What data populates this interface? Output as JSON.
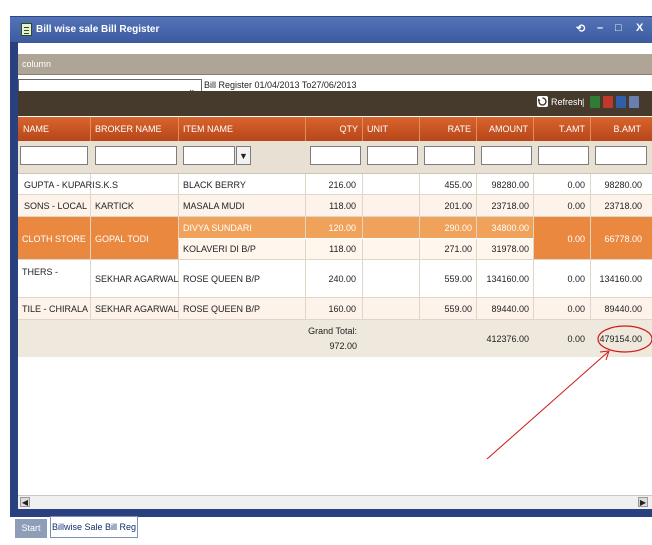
{
  "window": {
    "title": "Bill wise sale Bill Register",
    "controls": [
      "⟲",
      "–",
      "□",
      "X"
    ]
  },
  "column_bar": {
    "label": "column"
  },
  "report": {
    "title": "Bill Register 01/04/2013 To27/06/2013"
  },
  "toolbar": {
    "refresh_label": "Refresh",
    "separator": "|"
  },
  "filter_button": "▼",
  "columns": [
    "NAME",
    "BROKER NAME",
    "ITEM NAME",
    "QTY",
    "UNIT",
    "RATE",
    "AMOUNT",
    "T.AMT",
    "B.AMT"
  ],
  "rows": [
    {
      "name": "GUPTA - KUPARI",
      "broker": "S.K.S",
      "item": "BLACK BERRY",
      "qty": "216.00",
      "unit": "",
      "rate": "455.00",
      "amount": "98280.00",
      "tamt": "0.00",
      "bamt": "98280.00"
    },
    {
      "name": "SONS - LOCAL",
      "broker": "KARTICK",
      "item": "MASALA MUDI",
      "qty": "118.00",
      "unit": "",
      "rate": "201.00",
      "amount": "23718.00",
      "tamt": "0.00",
      "bamt": "23718.00"
    },
    {
      "name": "CLOTH STORE",
      "broker": "GOPAL TODI",
      "item": "DIVYA SUNDARI",
      "qty": "120.00",
      "unit": "",
      "rate": "290.00",
      "amount": "34800.00",
      "tamt": "0.00",
      "bamt": "66778.00",
      "item2": "KOLAVERI DI B/P",
      "qty2": "118.00",
      "rate2": "271.00",
      "amount2": "31978.00"
    },
    {
      "name": "THERS -",
      "broker": "SEKHAR AGARWAL",
      "item": "ROSE QUEEN B/P",
      "qty": "240.00",
      "unit": "",
      "rate": "559.00",
      "amount": "134160.00",
      "tamt": "0.00",
      "bamt": "134160.00"
    },
    {
      "name": "TILE - CHIRALA",
      "broker": "SEKHAR AGARWAL",
      "item": "ROSE QUEEN B/P",
      "qty": "160.00",
      "unit": "",
      "rate": "559.00",
      "amount": "89440.00",
      "tamt": "0.00",
      "bamt": "89440.00"
    }
  ],
  "totals": {
    "label": "Grand Total:",
    "qty": "972.00",
    "amount": "412376.00",
    "tamt": "0.00",
    "bamt": "479154.00"
  },
  "taskbar": {
    "start": "Start",
    "tab": "Billwise Sale Bill Reg"
  },
  "colors": {
    "header": "#c8521f",
    "selected_row": "#f0a15a",
    "titlebar": "#4a69ae",
    "annotation": "#d01818"
  }
}
